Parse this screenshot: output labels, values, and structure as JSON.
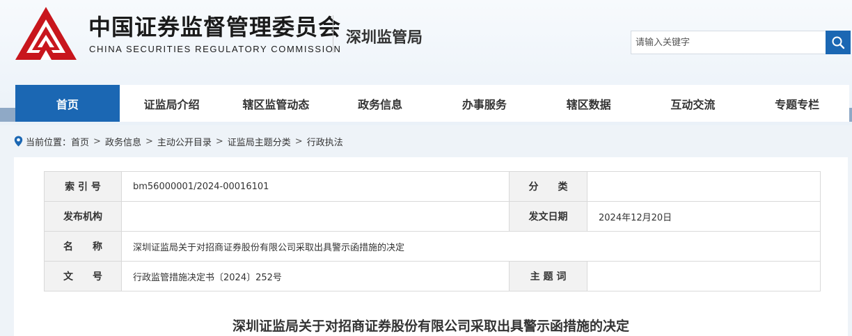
{
  "header": {
    "org_name_cn": "中国证券监督管理委员会",
    "org_name_en": "CHINA SECURITIES REGULATORY COMMISSION",
    "bureau_name": "深圳监管局",
    "logo_icon": "csrc-logo-icon",
    "brand_color": "#c8161d"
  },
  "search": {
    "placeholder": "请输入关键字",
    "button_icon": "search-icon",
    "button_color": "#1b67b3"
  },
  "nav": {
    "items": [
      "首页",
      "证监局介绍",
      "辖区监管动态",
      "政务信息",
      "办事服务",
      "辖区数据",
      "互动交流",
      "专题专栏"
    ],
    "active_index": 0
  },
  "breadcrumb": {
    "icon": "location-pin-icon",
    "prefix": "当前位置：",
    "items": [
      "首页",
      "政务信息",
      "主动公开目录",
      "证监局主题分类",
      "行政执法"
    ]
  },
  "meta_table": {
    "index_label": "索 引 号",
    "index_value": "bm56000001/2024-00016101",
    "category_label": "分　　类",
    "category_value": "",
    "publisher_label": "发布机构",
    "publisher_value": "",
    "date_label": "发文日期",
    "date_value": "2024年12月20日",
    "name_label": "名　　称",
    "name_value": "深圳证监局关于对招商证券股份有限公司采取出具警示函措施的决定",
    "doc_no_label": "文　　号",
    "doc_no_value": "行政监管措施决定书〔2024〕252号",
    "keywords_label": "主 题 词",
    "keywords_value": ""
  },
  "document": {
    "title": "深圳证监局关于对招商证券股份有限公司采取出具警示函措施的决定"
  }
}
